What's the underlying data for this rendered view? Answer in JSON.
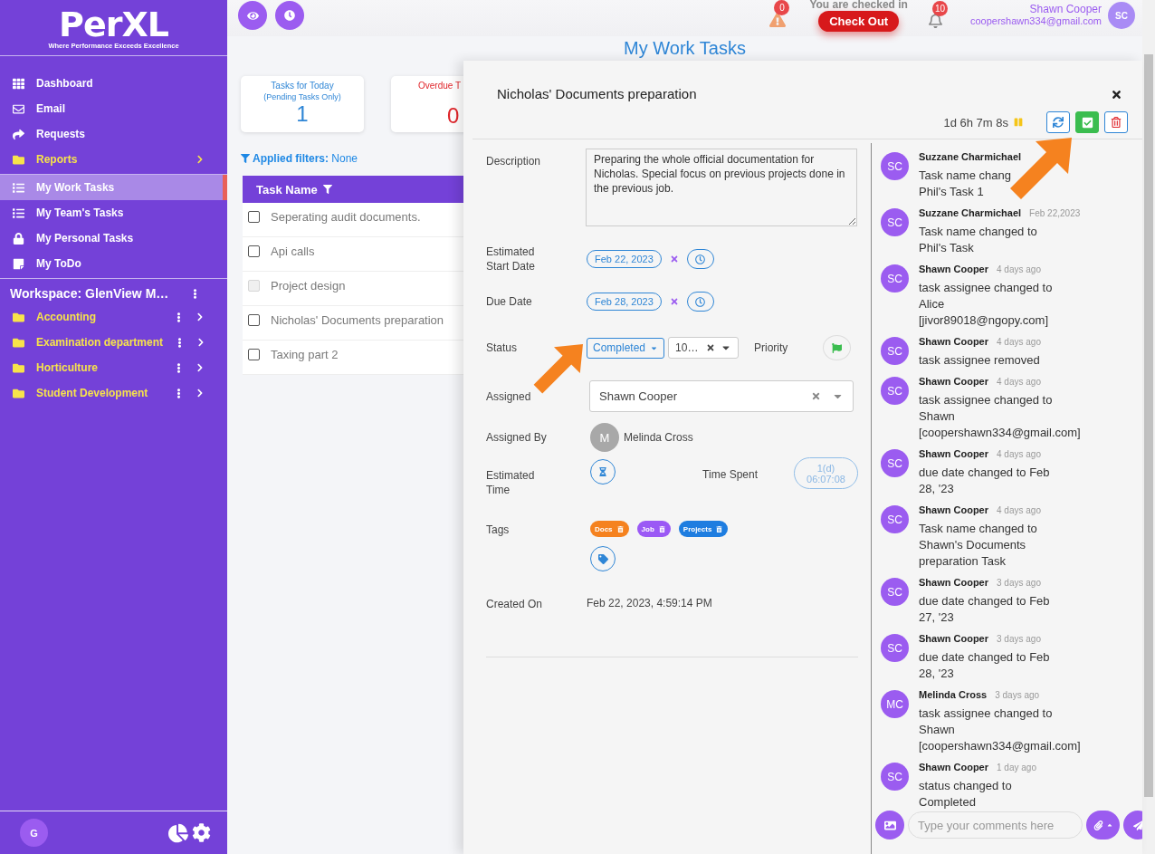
{
  "brand": {
    "name": "PerXL",
    "tagline": "Where Performance Exceeds Excellence"
  },
  "menu": {
    "primary": [
      {
        "label": "Dashboard",
        "kind": "link",
        "selected": false
      },
      {
        "label": "Email",
        "kind": "link",
        "selected": false
      },
      {
        "label": "Requests",
        "kind": "link",
        "selected": false
      },
      {
        "label": "Reports",
        "kind": "folder",
        "selected": false
      }
    ],
    "tasks": [
      {
        "label": "My Work Tasks",
        "kind": "link",
        "selected": true
      },
      {
        "label": "My Team's Tasks",
        "kind": "link",
        "selected": false
      },
      {
        "label": "My Personal Tasks",
        "kind": "link",
        "selected": false
      },
      {
        "label": "My ToDo",
        "kind": "link",
        "selected": false
      }
    ]
  },
  "workspace": {
    "title": "Workspace: GlenView M…",
    "folders": [
      {
        "label": "Accounting"
      },
      {
        "label": "Examination department"
      },
      {
        "label": "Horticulture"
      },
      {
        "label": "Student Development"
      }
    ]
  },
  "sidebar_footer": {
    "avatar": "G"
  },
  "header": {
    "alerts": "0",
    "checkin_text": "You are checked in",
    "checkout_button": "Check Out",
    "notifications": "10",
    "user_name": "Shawn Cooper",
    "user_email": "coopershawn334@gmail.com",
    "user_initials": "SC"
  },
  "page_title": "My Work Tasks",
  "stats": [
    {
      "title": "Tasks for Today",
      "subtitle": "(Pending Tasks Only)",
      "count": "1",
      "kind": "info"
    },
    {
      "title": "Overdue T",
      "count": "0",
      "kind": "danger"
    }
  ],
  "filters": "**Applied filters:** None",
  "task_table": {
    "column": "Task Name",
    "rows": [
      {
        "name": "Seperating audit documents.",
        "checked": false,
        "disabled": false
      },
      {
        "name": "Api calls",
        "checked": false,
        "disabled": false
      },
      {
        "name": "Project design",
        "checked": false,
        "disabled": true
      },
      {
        "name": "Nicholas' Documents preparation",
        "checked": false,
        "disabled": false
      },
      {
        "name": "Taxing part 2",
        "checked": false,
        "disabled": false
      }
    ]
  },
  "task_panel": {
    "title": "Nicholas' Documents preparation",
    "timer": "1d 6h 7m 8s",
    "description": {
      "label": "Description",
      "value": "Preparing the whole official documentation for Nicholas. Special focus on previous projects done in the previous job."
    },
    "start_date": {
      "label": "Estimated Start Date",
      "value": "Feb 22, 2023"
    },
    "due_date": {
      "label": "Due Date",
      "value": "Feb 28, 2023"
    },
    "status": {
      "label": "Status",
      "value": "Completed",
      "option": "10…",
      "priority_label": "Priority"
    },
    "assigned_to": {
      "label": "Assigned",
      "value": "Shawn Cooper"
    },
    "assigned_by": {
      "label": "Assigned By",
      "initial": "M",
      "name": "Melinda Cross"
    },
    "estimated_time": {
      "label": "Estimated Time",
      "spent_label": "Time Spent",
      "spent_days": "1(d)",
      "spent_time": "06:07:08"
    },
    "tags": {
      "label": "Tags",
      "items": [
        {
          "name": "Docs",
          "color": "#f5821f"
        },
        {
          "name": "Job",
          "color": "#9b59f5"
        },
        {
          "name": "Projects",
          "color": "#1e7de0"
        }
      ]
    },
    "created": {
      "label": "Created On",
      "value": "Feb 22, 2023, 4:59:14 PM"
    }
  },
  "comments": [
    {
      "initials": "SC",
      "author": "Suzzane Charmichael",
      "lines": [
        "Task name chang",
        "Phil's Task 1"
      ]
    },
    {
      "initials": "SC",
      "author": "Suzzane Charmichael",
      "time": "Feb 22,2023",
      "lines": [
        "Task name changed to",
        "Phil's Task"
      ]
    },
    {
      "initials": "SC",
      "author": "Shawn Cooper",
      "time": "4 days ago",
      "lines": [
        "task assignee changed to",
        "Alice",
        "[jivor89018@ngopy.com]"
      ]
    },
    {
      "initials": "SC",
      "author": "Shawn Cooper",
      "time": "4 days ago",
      "lines": [
        "task assignee removed"
      ]
    },
    {
      "initials": "SC",
      "author": "Shawn Cooper",
      "time": "4 days ago",
      "lines": [
        "task assignee changed to",
        "Shawn",
        "[coopershawn334@gmail.com]"
      ]
    },
    {
      "initials": "SC",
      "author": "Shawn Cooper",
      "time": "4 days ago",
      "lines": [
        "due date changed to Feb",
        "28, '23"
      ]
    },
    {
      "initials": "SC",
      "author": "Shawn Cooper",
      "time": "4 days ago",
      "lines": [
        "Task name changed to",
        "Shawn's Documents",
        "preparation Task"
      ]
    },
    {
      "initials": "SC",
      "author": "Shawn Cooper",
      "time": "3 days ago",
      "lines": [
        "due date changed to Feb",
        "27, '23"
      ]
    },
    {
      "initials": "SC",
      "author": "Shawn Cooper",
      "time": "3 days ago",
      "lines": [
        "due date changed to Feb",
        "28, '23"
      ]
    },
    {
      "initials": "MC",
      "author": "Melinda Cross",
      "time": "3 days ago",
      "lines": [
        "task assignee changed to",
        "Shawn",
        "[coopershawn334@gmail.com]"
      ]
    },
    {
      "initials": "SC",
      "author": "Shawn Cooper",
      "time": "1 day ago",
      "lines": [
        "status changed to",
        "Completed"
      ]
    }
  ],
  "comment_input": {
    "placeholder": "Type your comments here"
  }
}
